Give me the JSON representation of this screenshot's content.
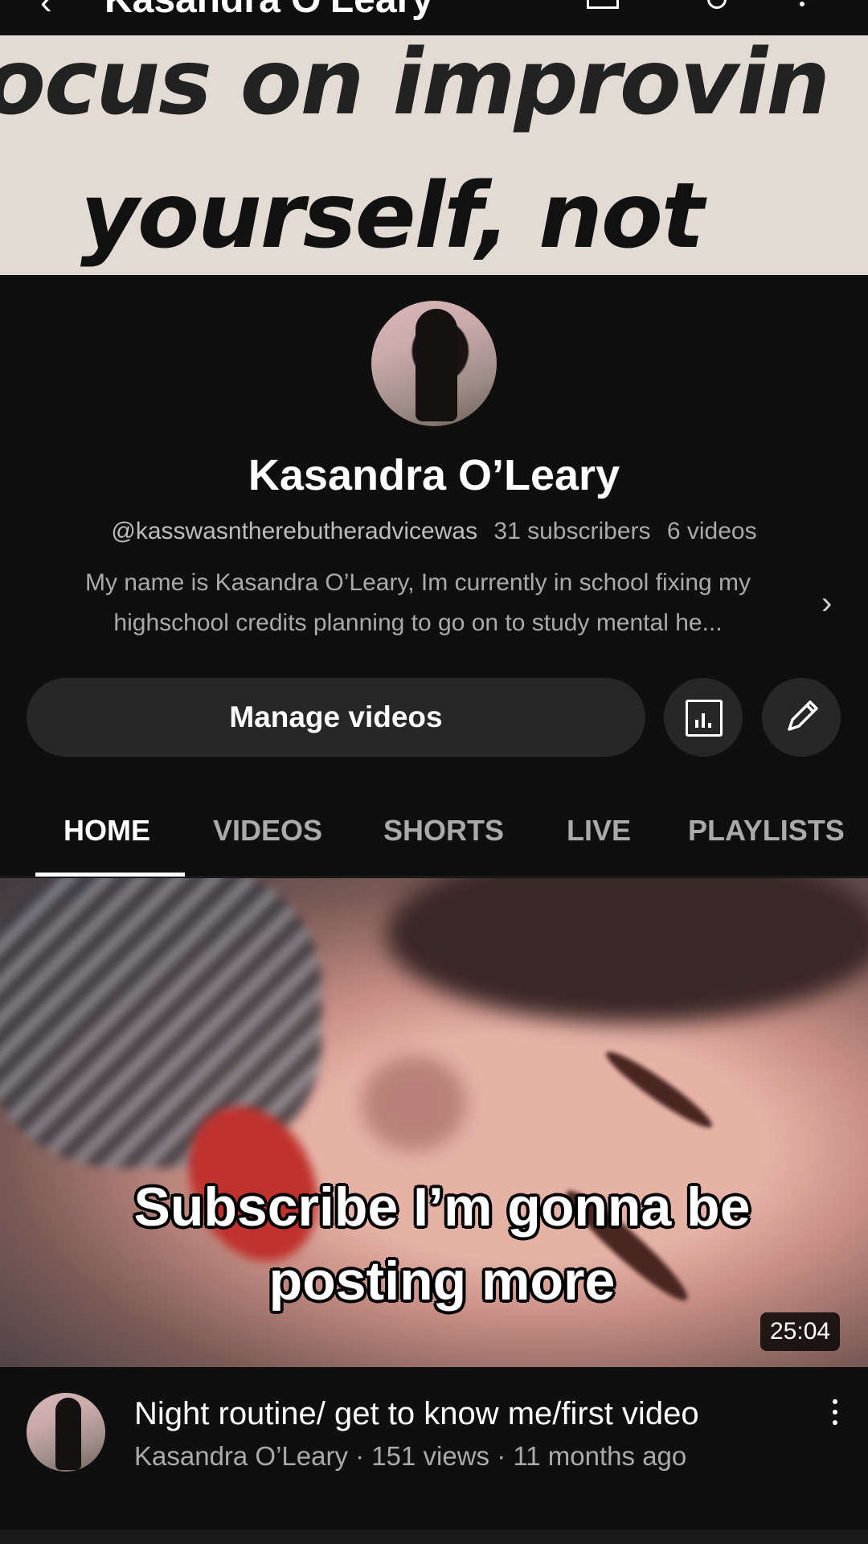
{
  "top_bar": {
    "back_icon": "back-arrow-icon",
    "title": "Kasandra O'Leary"
  },
  "banner": {
    "line1": "ocus on improvin",
    "line2": "yourself, not"
  },
  "channel": {
    "name": "Kasandra O’Leary",
    "handle": "@kasswasntherebutheradvicewas",
    "subscribers": "31 subscribers",
    "videos": "6 videos",
    "description": "My name is Kasandra O’Leary, Im currently in school fixing my highschool credits planning to go on to study mental he..."
  },
  "actions": {
    "manage_label": "Manage videos",
    "stats_icon": "analytics-icon",
    "edit_icon": "pencil-icon"
  },
  "tabs": [
    {
      "label": "HOME",
      "active": true
    },
    {
      "label": "VIDEOS",
      "active": false
    },
    {
      "label": "SHORTS",
      "active": false
    },
    {
      "label": "LIVE",
      "active": false
    },
    {
      "label": "PLAYLISTS",
      "active": false
    }
  ],
  "video": {
    "caption_line1": "Subscribe I’m gonna be",
    "caption_line2": "posting more",
    "duration": "25:04",
    "title": "Night routine/ get to know me/first video",
    "meta": "Kasandra O’Leary · 151 views · 11 months ago"
  },
  "colors": {
    "background": "#0f0f0f",
    "secondary_text": "#aaaaaa",
    "button_bg": "#272727"
  }
}
